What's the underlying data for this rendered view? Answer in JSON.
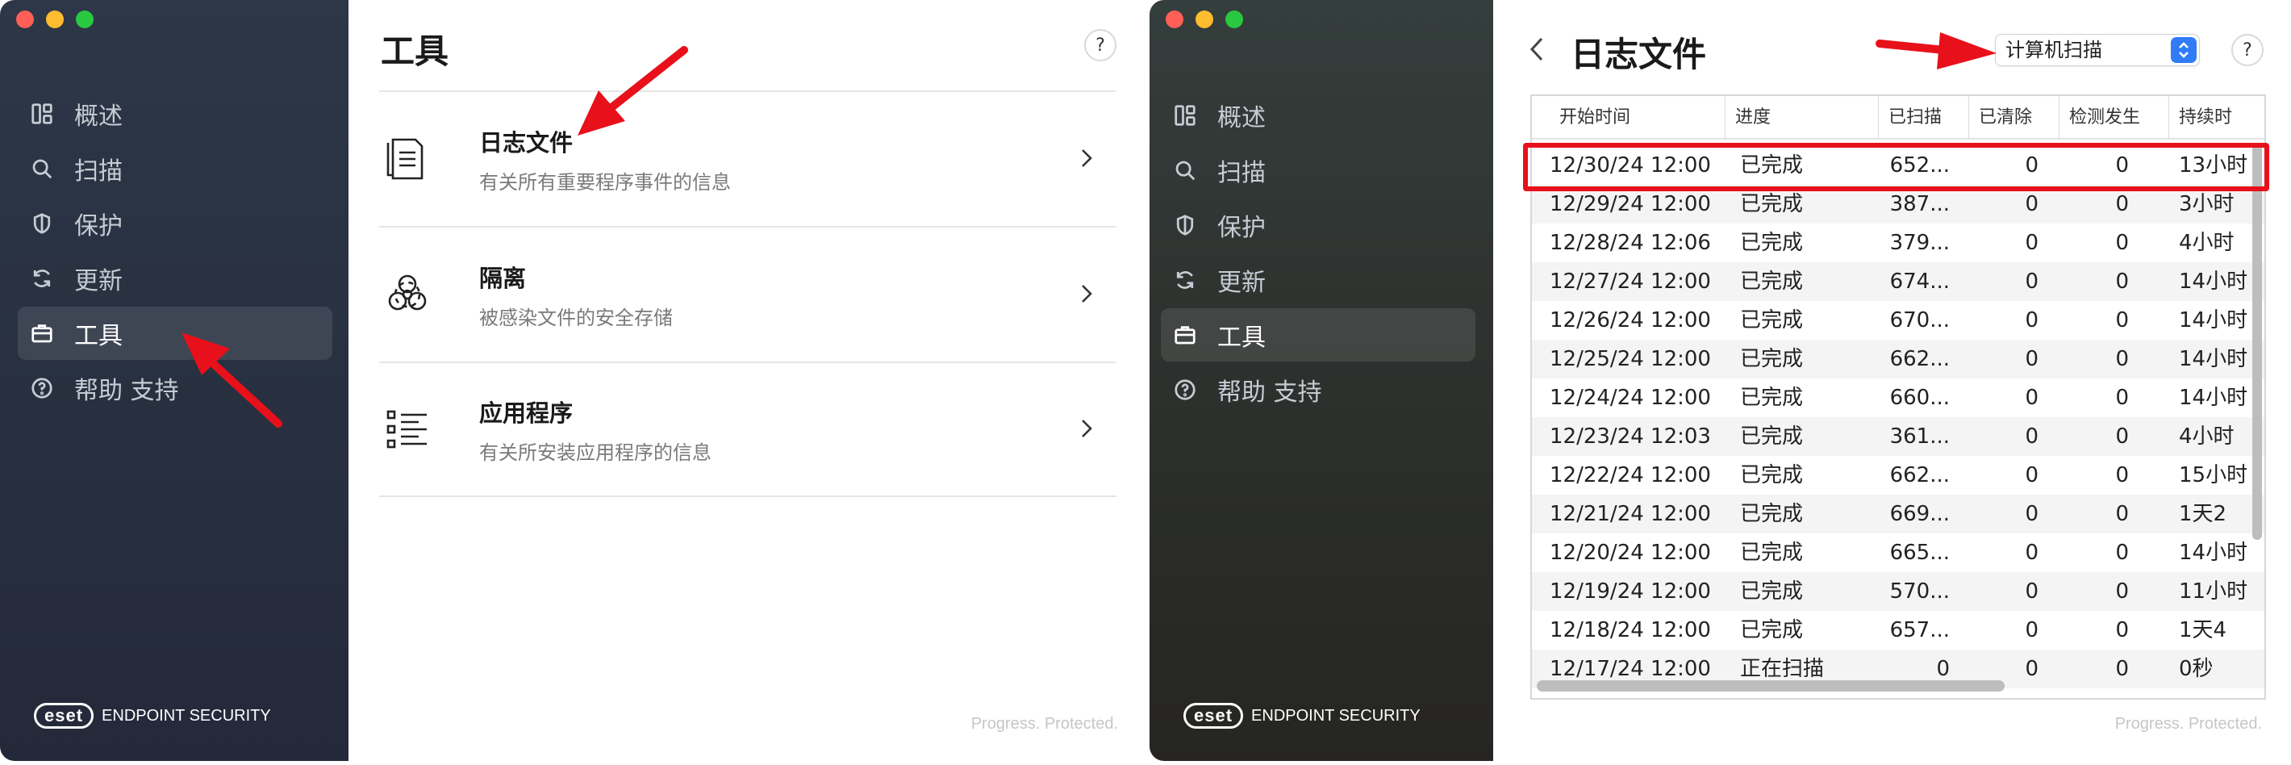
{
  "left_window": {
    "nav": [
      {
        "label": "概述",
        "icon": "dashboard-icon"
      },
      {
        "label": "扫描",
        "icon": "search-icon"
      },
      {
        "label": "保护",
        "icon": "shield-icon"
      },
      {
        "label": "更新",
        "icon": "refresh-icon"
      },
      {
        "label": "工具",
        "icon": "toolbox-icon",
        "active": true
      },
      {
        "label": "帮助 支持",
        "icon": "help-circle-icon"
      }
    ],
    "brand": {
      "logo": "eset",
      "text": "ENDPOINT SECURITY"
    },
    "title": "工具",
    "help": "?",
    "tools": [
      {
        "title": "日志文件",
        "desc": "有关所有重要程序事件的信息",
        "icon": "log-file-icon"
      },
      {
        "title": "隔离",
        "desc": "被感染文件的安全存储",
        "icon": "biohazard-icon"
      },
      {
        "title": "应用程序",
        "desc": "有关所安装应用程序的信息",
        "icon": "app-list-icon"
      }
    ],
    "footer": "Progress. Protected."
  },
  "right_window": {
    "nav": [
      {
        "label": "概述",
        "icon": "dashboard-icon"
      },
      {
        "label": "扫描",
        "icon": "search-icon"
      },
      {
        "label": "保护",
        "icon": "shield-icon"
      },
      {
        "label": "更新",
        "icon": "refresh-icon"
      },
      {
        "label": "工具",
        "icon": "toolbox-icon",
        "active": true
      },
      {
        "label": "帮助 支持",
        "icon": "help-circle-icon"
      }
    ],
    "brand": {
      "logo": "eset",
      "text": "ENDPOINT SECURITY"
    },
    "title": "日志文件",
    "select_value": "计算机扫描",
    "help": "?",
    "columns": [
      "开始时间",
      "进度",
      "已扫描",
      "已清除",
      "检测发生",
      "持续时"
    ],
    "rows": [
      [
        "12/30/24 12:00",
        "已完成",
        "652...",
        "0",
        "0",
        "13小时"
      ],
      [
        "12/29/24 12:00",
        "已完成",
        "387...",
        "0",
        "0",
        "3小时"
      ],
      [
        "12/28/24 12:06",
        "已完成",
        "379...",
        "0",
        "0",
        "4小时"
      ],
      [
        "12/27/24 12:00",
        "已完成",
        "674...",
        "0",
        "0",
        "14小时"
      ],
      [
        "12/26/24 12:00",
        "已完成",
        "670...",
        "0",
        "0",
        "14小时"
      ],
      [
        "12/25/24 12:00",
        "已完成",
        "662...",
        "0",
        "0",
        "14小时"
      ],
      [
        "12/24/24 12:00",
        "已完成",
        "660...",
        "0",
        "0",
        "14小时"
      ],
      [
        "12/23/24 12:03",
        "已完成",
        "361...",
        "0",
        "0",
        "4小时"
      ],
      [
        "12/22/24 12:00",
        "已完成",
        "662...",
        "0",
        "0",
        "15小时"
      ],
      [
        "12/21/24 12:00",
        "已完成",
        "669...",
        "0",
        "0",
        "1天2"
      ],
      [
        "12/20/24 12:00",
        "已完成",
        "665...",
        "0",
        "0",
        "14小时"
      ],
      [
        "12/19/24 12:00",
        "已完成",
        "570...",
        "0",
        "0",
        "11小时"
      ],
      [
        "12/18/24 12:00",
        "已完成",
        "657...",
        "0",
        "0",
        "1天4"
      ],
      [
        "12/17/24 12:00",
        "正在扫描",
        "0",
        "0",
        "0",
        "0秒"
      ]
    ],
    "footer": "Progress. Protected."
  },
  "colors": {
    "arrow_red": "#e8101a",
    "select_accent": "#2f7cf6"
  }
}
